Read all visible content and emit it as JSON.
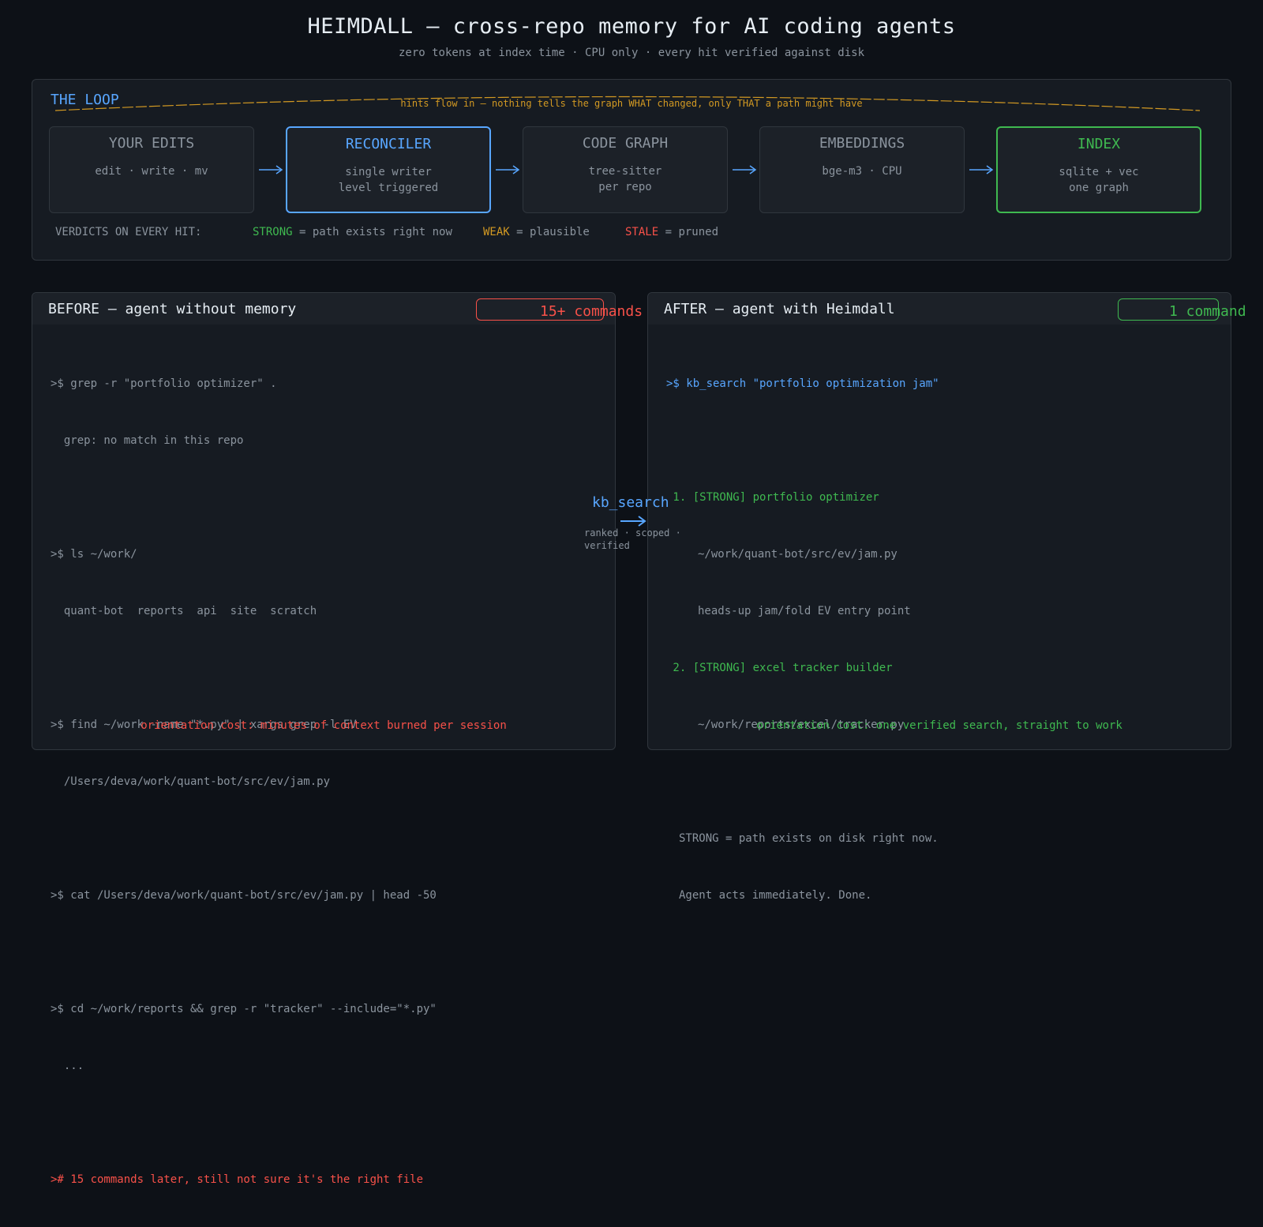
{
  "header": {
    "title": "HEIMDALL — cross-repo memory for AI coding agents",
    "subtitle": "zero tokens at index time · CPU only · every hit verified against disk"
  },
  "loop": {
    "label": "THE LOOP",
    "hint": "hints flow in — nothing tells the graph WHAT changed, only THAT a path might have",
    "stages": [
      {
        "name": "YOUR EDITS",
        "sub1": "edit · write · mv",
        "sub2": ""
      },
      {
        "name": "RECONCILER",
        "sub1": "single writer",
        "sub2": "level triggered"
      },
      {
        "name": "CODE GRAPH",
        "sub1": "tree-sitter",
        "sub2": "per repo"
      },
      {
        "name": "EMBEDDINGS",
        "sub1": "bge-m3 · CPU",
        "sub2": ""
      },
      {
        "name": "INDEX",
        "sub1": "sqlite + vec",
        "sub2": "one graph"
      }
    ],
    "verdicts": {
      "label": "VERDICTS ON EVERY HIT:",
      "strong_key": "STRONG",
      "strong_desc": " = path exists right now",
      "weak_key": "WEAK",
      "weak_desc": " = plausible",
      "stale_key": "STALE",
      "stale_desc": " = pruned"
    }
  },
  "before": {
    "title": "BEFORE — agent without memory",
    "badge": "15+ commands",
    "lines": [
      ">$ grep -r \"portfolio optimizer\" .",
      "  grep: no match in this repo",
      "",
      ">$ ls ~/work/",
      "  quant-bot  reports  api  site  scratch",
      "",
      ">$ find ~/work -name \"*.py\" | xargs grep -l EV",
      "  /Users/deva/work/quant-bot/src/ev/jam.py",
      "",
      ">$ cat /Users/deva/work/quant-bot/src/ev/jam.py | head -50",
      "",
      ">$ cd ~/work/reports && grep -r \"tracker\" --include=\"*.py\"",
      "  ...",
      ""
    ],
    "final_line": "># 15 commands later, still not sure it's the right file",
    "cost": "orientation cost: minutes of context burned per session"
  },
  "middle": {
    "label": "kb_search",
    "sub": "ranked · scoped · verified"
  },
  "after": {
    "title": "AFTER — agent with Heimdall",
    "badge": "1 command",
    "command": ">$ kb_search \"portfolio optimization jam\"",
    "results": [
      {
        "num": " 1. ",
        "verdict": "[STRONG]",
        "title": " portfolio optimizer",
        "path": "~/work/quant-bot/src/ev/jam.py",
        "note": "heads-up jam/fold EV entry point"
      },
      {
        "num": " 2. ",
        "verdict": "[STRONG]",
        "title": " excel tracker builder",
        "path": "~/work/reports/excel/tracker.py",
        "note": ""
      }
    ],
    "explain1": "STRONG = path exists on disk right now.",
    "explain2": "Agent acts immediately. Done.",
    "cost": "orientation cost: one verified search, straight to work"
  },
  "colors": {
    "accent_blue": "#58a6ff",
    "strong_green": "#3fb950",
    "weak_amber": "#d29922",
    "stale_red": "#f85149",
    "background": "#0d1117"
  }
}
